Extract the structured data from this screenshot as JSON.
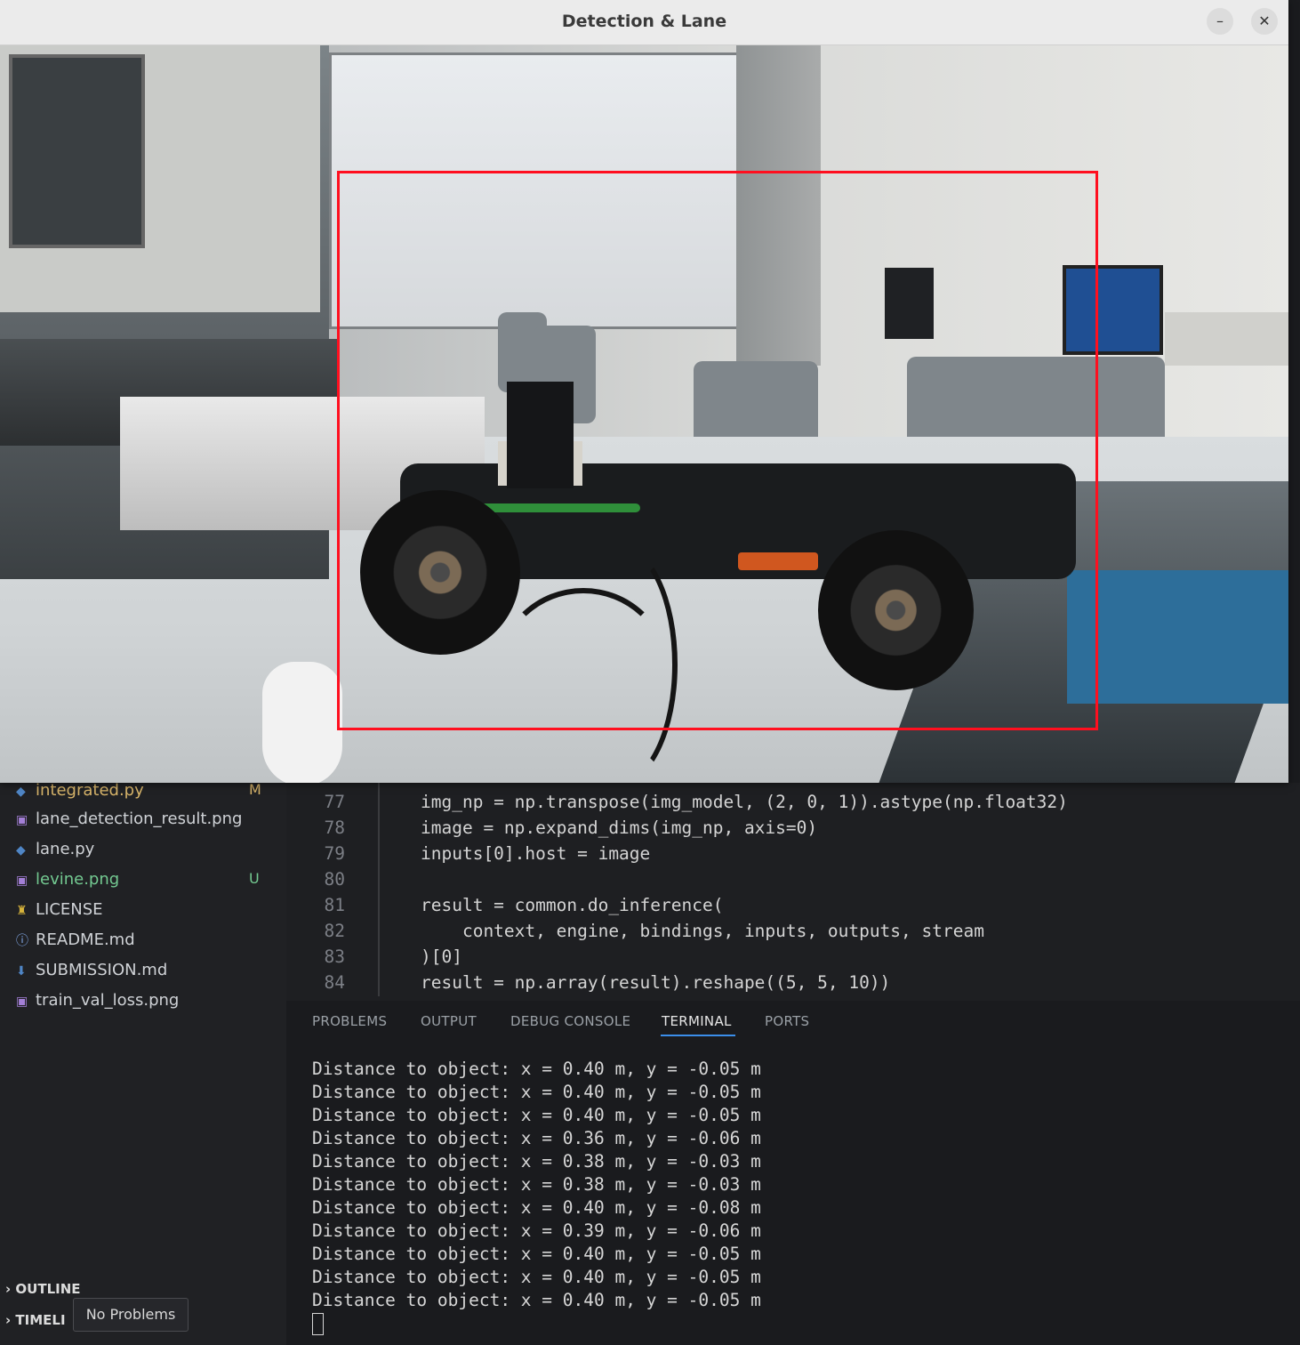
{
  "window": {
    "title": "Detection & Lane",
    "minimize_glyph": "–",
    "close_glyph": "✕"
  },
  "explorer": {
    "files": [
      {
        "name": "integrated.py",
        "icon": "python-file-icon",
        "badge": "M",
        "color": "#d7b46a"
      },
      {
        "name": "lane_detection_result.png",
        "icon": "image-file-icon",
        "badge": "",
        "color": "#cfd2d6"
      },
      {
        "name": "lane.py",
        "icon": "python-file-icon",
        "badge": "",
        "color": "#cfd2d6"
      },
      {
        "name": "levine.png",
        "icon": "image-file-icon",
        "badge": "U",
        "color": "#73c991"
      },
      {
        "name": "LICENSE",
        "icon": "license-icon",
        "badge": "",
        "color": "#cfd2d6"
      },
      {
        "name": "README.md",
        "icon": "info-icon",
        "badge": "",
        "color": "#cfd2d6"
      },
      {
        "name": "SUBMISSION.md",
        "icon": "download-arrow-icon",
        "badge": "",
        "color": "#cfd2d6"
      },
      {
        "name": "train_val_loss.png",
        "icon": "image-file-icon",
        "badge": "",
        "color": "#cfd2d6"
      }
    ],
    "outline_label": "OUTLINE",
    "timeline_label": "TIMELI",
    "tooltip": "No Problems"
  },
  "editor": {
    "lines": [
      {
        "n": "77",
        "text": "img_np = np.transpose(img_model, (2, 0, 1)).astype(np.float32)"
      },
      {
        "n": "78",
        "text": "image = np.expand_dims(img_np, axis=0)"
      },
      {
        "n": "79",
        "text": "inputs[0].host = image"
      },
      {
        "n": "80",
        "text": ""
      },
      {
        "n": "81",
        "text": "result = common.do_inference("
      },
      {
        "n": "82",
        "text": "    context, engine, bindings, inputs, outputs, stream"
      },
      {
        "n": "83",
        "text": ")[0]"
      },
      {
        "n": "84",
        "text": "result = np.array(result).reshape((5, 5, 10))"
      }
    ]
  },
  "panel": {
    "tabs": [
      "PROBLEMS",
      "OUTPUT",
      "DEBUG CONSOLE",
      "TERMINAL",
      "PORTS"
    ],
    "active_tab": "TERMINAL",
    "terminal_lines": [
      "Distance to object: x = 0.40 m, y = -0.05 m",
      "Distance to object: x = 0.40 m, y = -0.05 m",
      "Distance to object: x = 0.40 m, y = -0.05 m",
      "Distance to object: x = 0.36 m, y = -0.06 m",
      "Distance to object: x = 0.38 m, y = -0.03 m",
      "Distance to object: x = 0.38 m, y = -0.03 m",
      "Distance to object: x = 0.40 m, y = -0.08 m",
      "Distance to object: x = 0.39 m, y = -0.06 m",
      "Distance to object: x = 0.40 m, y = -0.05 m",
      "Distance to object: x = 0.40 m, y = -0.05 m",
      "Distance to object: x = 0.40 m, y = -0.05 m"
    ]
  },
  "colors": {
    "bbox": "#ff0f1f",
    "terminal_bg": "#1a1b1e",
    "accent": "#3b8eea"
  }
}
